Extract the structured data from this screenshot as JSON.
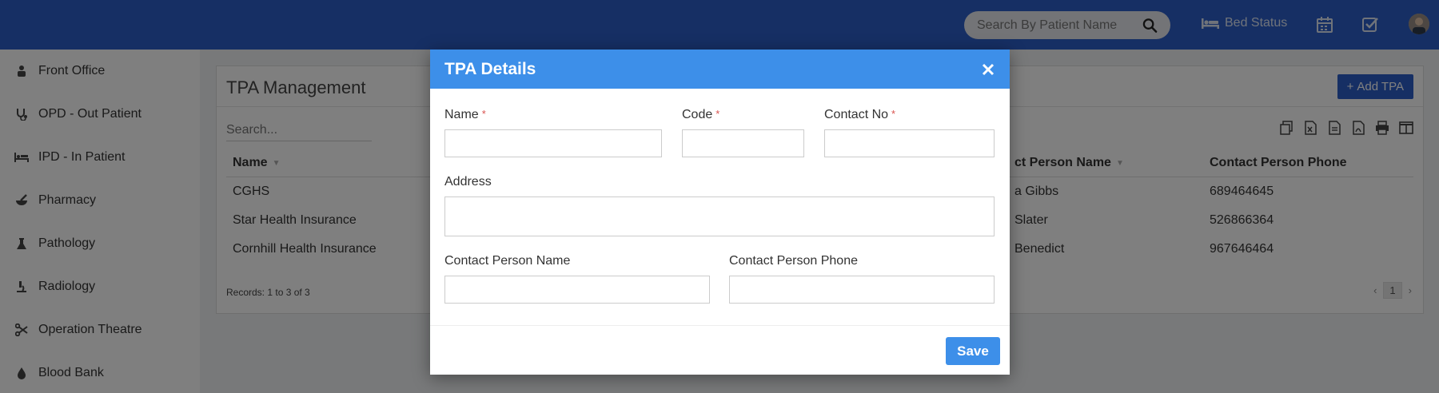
{
  "header": {
    "search_placeholder": "Search By Patient Name",
    "bed_status_label": "Bed Status",
    "icons": [
      "search-icon",
      "bed-icon",
      "calendar-icon",
      "task-check-icon",
      "user-avatar"
    ]
  },
  "sidebar": {
    "items": [
      {
        "label": "Front Office",
        "icon": "front-office-icon"
      },
      {
        "label": "OPD - Out Patient",
        "icon": "stethoscope-icon"
      },
      {
        "label": "IPD - In Patient",
        "icon": "bed-icon"
      },
      {
        "label": "Pharmacy",
        "icon": "mortar-pestle-icon"
      },
      {
        "label": "Pathology",
        "icon": "flask-icon"
      },
      {
        "label": "Radiology",
        "icon": "microscope-icon"
      },
      {
        "label": "Operation Theatre",
        "icon": "scissors-icon"
      },
      {
        "label": "Blood Bank",
        "icon": "blood-drop-icon"
      }
    ]
  },
  "panel": {
    "title": "TPA Management",
    "add_button_label": "Add TPA",
    "search_placeholder": "Search...",
    "columns": [
      "Name",
      "ct Person Name",
      "Contact Person Phone"
    ],
    "rows": [
      {
        "name": "CGHS",
        "contact_person": "a Gibbs",
        "phone": "689464645"
      },
      {
        "name": "Star Health Insurance",
        "contact_person": "Slater",
        "phone": "526866364"
      },
      {
        "name": "Cornhill Health Insurance",
        "contact_person": "Benedict",
        "phone": "967646464"
      }
    ],
    "records_text": "Records: 1 to 3 of 3",
    "pager": {
      "prev": "‹",
      "page": "1",
      "next": "›"
    }
  },
  "modal": {
    "title": "TPA Details",
    "close_glyph": "×",
    "fields": {
      "name_label": "Name",
      "code_label": "Code",
      "contact_no_label": "Contact No",
      "address_label": "Address",
      "contact_person_name_label": "Contact Person Name",
      "contact_person_phone_label": "Contact Person Phone",
      "required_mark": "*",
      "name_value": "",
      "code_value": "",
      "contact_no_value": "",
      "address_value": "",
      "contact_person_name_value": "",
      "contact_person_phone_value": ""
    },
    "save_label": "Save"
  },
  "colors": {
    "topbar": "#2c5fc9",
    "modal_header": "#3d8fe9",
    "required": "#d9534f"
  }
}
